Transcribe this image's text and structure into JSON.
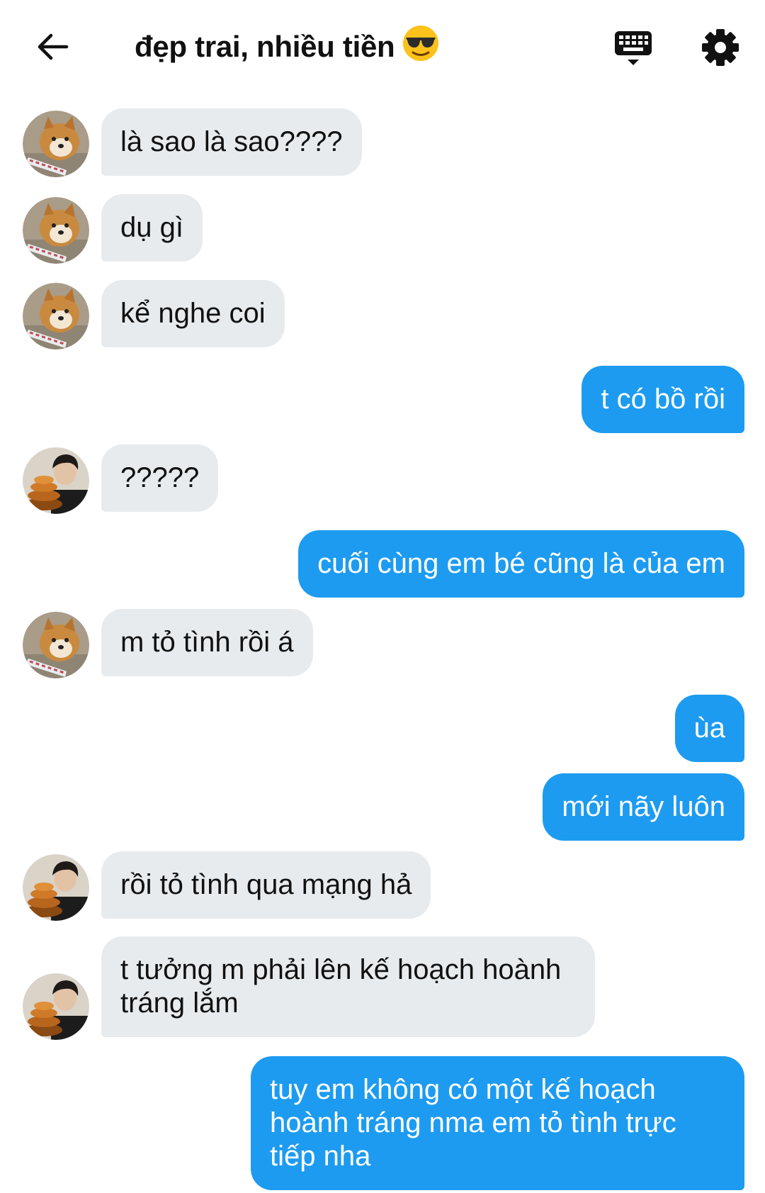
{
  "header": {
    "title": "đẹp trai, nhiều tiền",
    "title_emoji": "smiling-face-with-sunglasses",
    "icons": [
      "back-arrow-icon",
      "keyboard-shortcuts-icon",
      "gear-icon"
    ]
  },
  "colors": {
    "incoming_bubble": "#e8ebee",
    "outgoing_bubble": "#1d9bf0",
    "outgoing_text": "#ffffff"
  },
  "messages": [
    {
      "from": "them",
      "sender": "shiba-avatar",
      "text": "là sao là sao????"
    },
    {
      "from": "them",
      "sender": "shiba-avatar",
      "text": "dụ gì"
    },
    {
      "from": "them",
      "sender": "shiba-avatar",
      "text": "kể nghe coi"
    },
    {
      "from": "me",
      "text": "t có bồ rồi"
    },
    {
      "from": "them",
      "sender": "person-avatar",
      "text": "?????"
    },
    {
      "from": "me",
      "text": "cuối cùng em bé cũng là của em"
    },
    {
      "from": "them",
      "sender": "shiba-avatar",
      "text": "m tỏ tình rồi á"
    },
    {
      "from": "me",
      "text": "ùa"
    },
    {
      "from": "me",
      "text": "mới nãy luôn"
    },
    {
      "from": "them",
      "sender": "person-avatar",
      "text": "rồi tỏ tình qua mạng hả"
    },
    {
      "from": "them",
      "sender": "person-avatar",
      "text": "t tưởng m phải lên kế hoạch hoành tráng lắm"
    },
    {
      "from": "me",
      "text": "tuy em không có một kế hoạch hoành tráng nma em tỏ tình trực tiếp nha"
    }
  ]
}
